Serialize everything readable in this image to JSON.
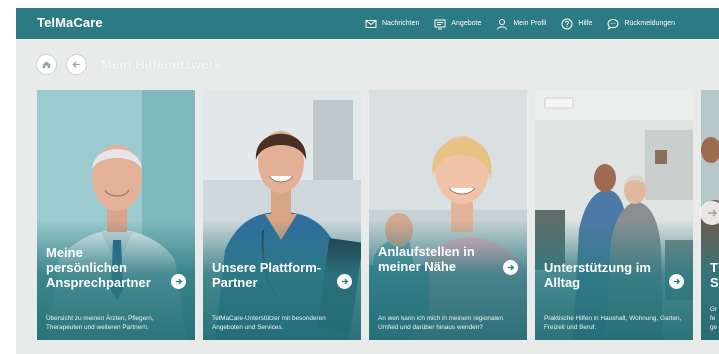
{
  "app": {
    "logo": "TelMaCare"
  },
  "nav": [
    {
      "label": "Nachrichten",
      "icon": "envelope-icon"
    },
    {
      "label": "Angebote",
      "icon": "offers-icon"
    },
    {
      "label": "Mein Profil",
      "icon": "user-icon"
    },
    {
      "label": "Hilfe",
      "icon": "help-icon"
    },
    {
      "label": "Rückmeldungen",
      "icon": "chat-bubble-icon"
    }
  ],
  "breadcrumb": {
    "title": "Mein Hilfenetzwerk"
  },
  "cards": [
    {
      "title": "Meine persönlichen Ansprechpartner",
      "description": "Übersicht zu meinen Ärzten, Pflegern, Therapeuten und weiteren Partnern."
    },
    {
      "title": "Unsere Plattform-Partner",
      "description": "TelMaCare-Unterstützer mit besonderen Angeboten und Services."
    },
    {
      "title": "Anlaufstellen in meiner Nähe",
      "description": "An wen kann ich mich in meinem regionalen Umfeld und darüber hinaus wenden?"
    },
    {
      "title": "Unterstützung im Alltag",
      "description": "Praktische Hilfen in Haushalt, Wohnung, Garten, Freizeit und Beruf."
    },
    {
      "title": "T S",
      "description": "Gr fe ge"
    }
  ],
  "colors": {
    "brand": "#2c7a82",
    "background": "#e9eaea"
  }
}
